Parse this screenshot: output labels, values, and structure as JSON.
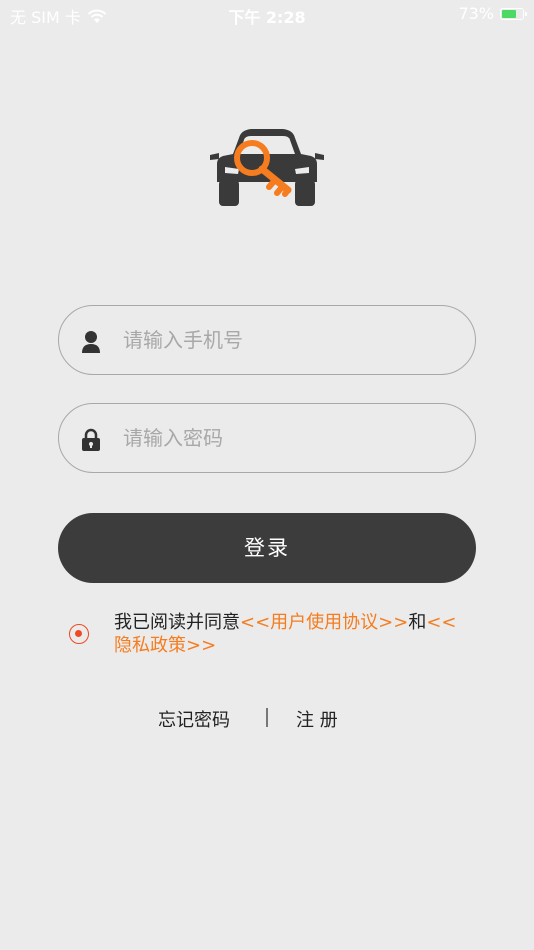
{
  "status_bar": {
    "carrier": "无 SIM 卡",
    "time": "下午 2:28",
    "battery_percent": "73%",
    "battery_level": 0.73
  },
  "login_form": {
    "phone_placeholder": "请输入手机号",
    "password_placeholder": "请输入密码",
    "login_label": "登录"
  },
  "agreement": {
    "checked": true,
    "prefix": "我已阅读并同意",
    "user_agreement": "<<用户使用协议>>",
    "conjunction": "和",
    "privacy_policy": "<<隐私政策>>"
  },
  "footer_links": {
    "forgot_password": "忘记密码",
    "register": "注 册"
  },
  "colors": {
    "accent": "#f57c1f",
    "radio": "#ef4a23",
    "button": "#3c3c3c",
    "background": "#ebebeb"
  },
  "icons": [
    "wifi-icon",
    "battery-icon",
    "car-key-logo",
    "user-icon",
    "lock-icon",
    "radio-checked-icon"
  ]
}
